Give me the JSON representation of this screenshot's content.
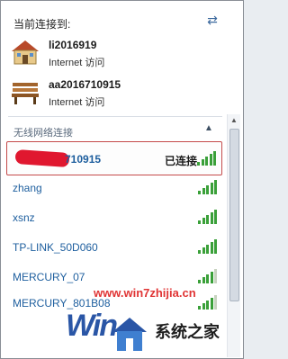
{
  "header": {
    "title": "当前连接到:"
  },
  "current_connections": [
    {
      "name": "li2016919",
      "status": "Internet 访问",
      "icon": "house-icon"
    },
    {
      "name": "aa2016710915",
      "status": "Internet 访问",
      "icon": "bench-icon"
    }
  ],
  "wireless": {
    "section_title": "无线网络连接",
    "networks": [
      {
        "name": "aa2016710915",
        "visible_name": "710915",
        "status": "已连接",
        "signal": 5,
        "selected": true
      },
      {
        "name": "zhang",
        "signal": 5
      },
      {
        "name": "xsnz",
        "signal": 5
      },
      {
        "name": "TP-LINK_50D060",
        "signal": 5
      },
      {
        "name": "MERCURY_07",
        "signal": 4
      },
      {
        "name": "MERCURY_801B08",
        "signal": 4
      }
    ]
  },
  "watermark": {
    "text": "www.win7zhijia.cn",
    "site": "系统之家"
  },
  "colors": {
    "accent": "#1d5e9e",
    "signal": "#3aa039",
    "redaction": "#e0172f"
  }
}
